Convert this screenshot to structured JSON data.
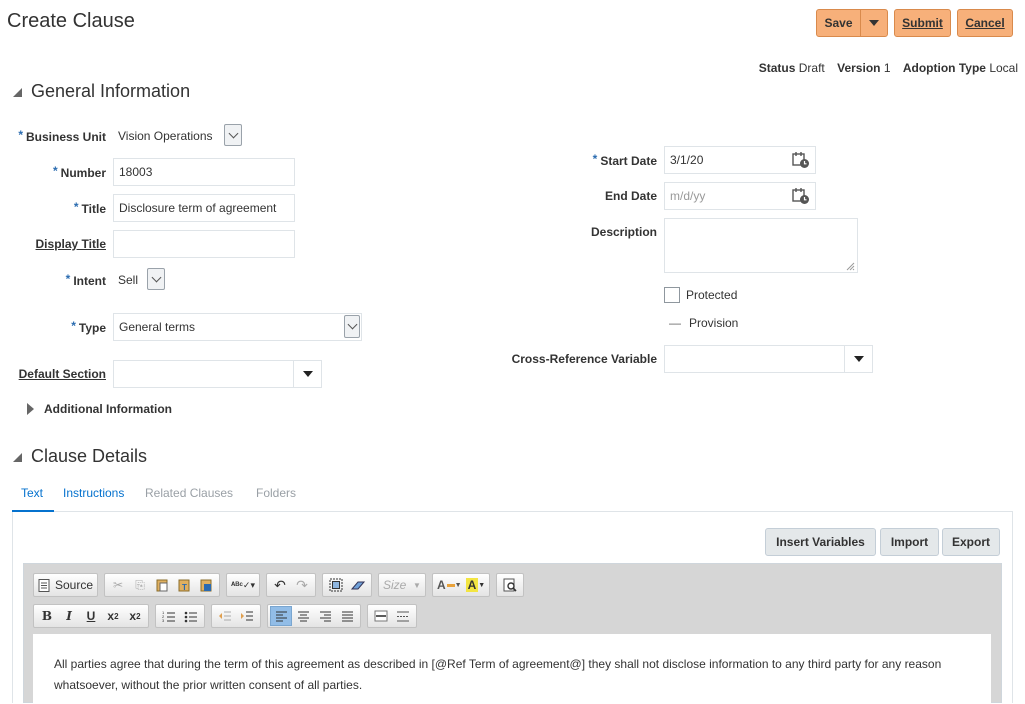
{
  "header": {
    "title": "Create Clause",
    "save_label": "Save",
    "submit_label": "Submit",
    "cancel_label": "Cancel"
  },
  "status": {
    "status_label": "Status",
    "status_value": "Draft",
    "version_label": "Version",
    "version_value": "1",
    "adoption_label": "Adoption Type",
    "adoption_value": "Local"
  },
  "general": {
    "heading": "General Information",
    "business_unit": {
      "label": "Business Unit",
      "value": "Vision Operations"
    },
    "number": {
      "label": "Number",
      "value": "18003"
    },
    "title": {
      "label": "Title",
      "value": "Disclosure term of agreement"
    },
    "display_title": {
      "label": "Display Title",
      "value": ""
    },
    "intent": {
      "label": "Intent",
      "value": "Sell"
    },
    "type": {
      "label": "Type",
      "value": "General terms"
    },
    "default_section": {
      "label": "Default Section",
      "value": ""
    },
    "start_date": {
      "label": "Start Date",
      "value": "3/1/20"
    },
    "end_date": {
      "label": "End Date",
      "placeholder": "m/d/yy"
    },
    "description": {
      "label": "Description",
      "value": ""
    },
    "protected_label": "Protected",
    "provision_label": "Provision",
    "provision_dash": "—",
    "cross_reference": {
      "label": "Cross-Reference Variable",
      "value": ""
    },
    "additional_info": "Additional Information"
  },
  "details": {
    "heading": "Clause Details",
    "tabs": [
      "Text",
      "Instructions",
      "Related Clauses",
      "Folders"
    ],
    "insert_variables": "Insert Variables",
    "import": "Import",
    "export": "Export"
  },
  "editor": {
    "source_label": "Source",
    "size_label": "Size",
    "content": "All parties agree that during the term of this agreement as described in [@Ref Term of agreement@] they shall not disclose information to any third party for any reason whatsoever, without the prior written consent of all parties."
  },
  "colors": {
    "accent_orange": "#f7b07a",
    "link_blue": "#0572ce",
    "required_star": "#2b6cb0"
  }
}
